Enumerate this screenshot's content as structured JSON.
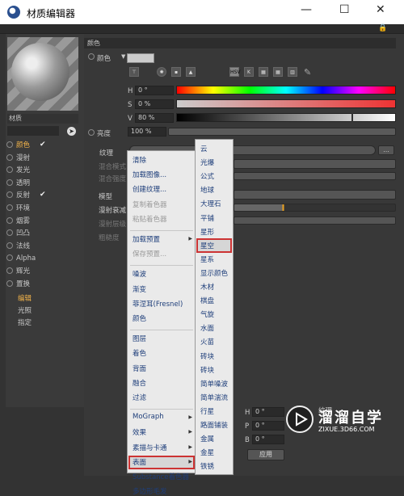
{
  "window": {
    "title": "材质编辑器",
    "min": "—",
    "max": "☐",
    "close": "✕"
  },
  "left": {
    "material_name": "材质",
    "channels": [
      {
        "label": "颜色",
        "active": true,
        "checked": true
      },
      {
        "label": "漫射",
        "active": false,
        "checked": false
      },
      {
        "label": "发光",
        "active": false,
        "checked": false
      },
      {
        "label": "透明",
        "active": false,
        "checked": false
      },
      {
        "label": "反射",
        "active": false,
        "checked": true
      },
      {
        "label": "环境",
        "active": false,
        "checked": false
      },
      {
        "label": "烟雾",
        "active": false,
        "checked": false
      },
      {
        "label": "凹凸",
        "active": false,
        "checked": false
      },
      {
        "label": "法线",
        "active": false,
        "checked": false
      },
      {
        "label": "Alpha",
        "active": false,
        "checked": false
      },
      {
        "label": "辉光",
        "active": false,
        "checked": false
      },
      {
        "label": "置换",
        "active": false,
        "checked": false
      }
    ],
    "sub_items": [
      {
        "label": "编辑",
        "active": true
      },
      {
        "label": "光照",
        "active": false
      },
      {
        "label": "指定",
        "active": false
      }
    ]
  },
  "color_section": {
    "header": "颜色",
    "color_label": "颜色",
    "h_label": "H",
    "h_value": "0 °",
    "s_label": "S",
    "s_value": "0 %",
    "v_label": "V",
    "v_value": "80 %",
    "v_level": 0.8,
    "brightness_label": "亮度",
    "brightness_value": "100 %",
    "texture_label": "纹理",
    "mix_mode_label": "混合模式",
    "mix_strength_label": "混合强度",
    "model_label": "模型",
    "diffuse_falloff_label": "漫射衰减",
    "diffuse_level_label": "漫射层级",
    "roughness_label": "粗糙度",
    "hsv_tab": "HSV",
    "more_button": "..."
  },
  "context_menu": {
    "groups": [
      [
        {
          "label": "清除",
          "enabled": true
        },
        {
          "label": "加载图像...",
          "enabled": true
        },
        {
          "label": "创建纹理...",
          "enabled": true
        },
        {
          "label": "复制着色器",
          "enabled": false
        },
        {
          "label": "粘贴着色器",
          "enabled": false
        }
      ],
      [
        {
          "label": "加载预置",
          "enabled": true,
          "submenu": true
        },
        {
          "label": "保存预置...",
          "enabled": false
        }
      ],
      [
        {
          "label": "噪波",
          "enabled": true
        },
        {
          "label": "渐变",
          "enabled": true
        },
        {
          "label": "菲涅耳(Fresnel)",
          "enabled": true
        },
        {
          "label": "颜色",
          "enabled": true
        }
      ],
      [
        {
          "label": "图层",
          "enabled": true
        },
        {
          "label": "着色",
          "enabled": true
        },
        {
          "label": "背面",
          "enabled": true
        },
        {
          "label": "融合",
          "enabled": true
        },
        {
          "label": "过滤",
          "enabled": true
        }
      ],
      [
        {
          "label": "MoGraph",
          "enabled": true,
          "submenu": true
        },
        {
          "label": "效果",
          "enabled": true,
          "submenu": true
        },
        {
          "label": "素描与卡通",
          "enabled": true,
          "submenu": true
        },
        {
          "label": "表面",
          "enabled": true,
          "submenu": true,
          "highlighted": true
        },
        {
          "label": "Substance着色器",
          "enabled": true
        },
        {
          "label": "多边形毛发",
          "enabled": true
        }
      ]
    ]
  },
  "surface_submenu": {
    "items": [
      "云",
      "光爆",
      "公式",
      "地球",
      "大理石",
      "平铺",
      "星形",
      "星空",
      "星系",
      "显示颜色",
      "木材",
      "棋盘",
      "气旋",
      "水面",
      "火苗",
      "砖块",
      "砖块",
      "简单噪波",
      "简单湍流",
      "行星",
      "路面铺装",
      "金属",
      "金星",
      "铁锈"
    ],
    "highlighted": "星空"
  },
  "bottom": {
    "coords": [
      "H",
      "P",
      "B"
    ],
    "coord_values": [
      "0 °",
      "0 °",
      "0 °"
    ],
    "texture_label": "纹理",
    "apply_button": "应用"
  },
  "watermark": {
    "name": "溜溜自学",
    "url": "ZIXUE.3D66.COM"
  }
}
